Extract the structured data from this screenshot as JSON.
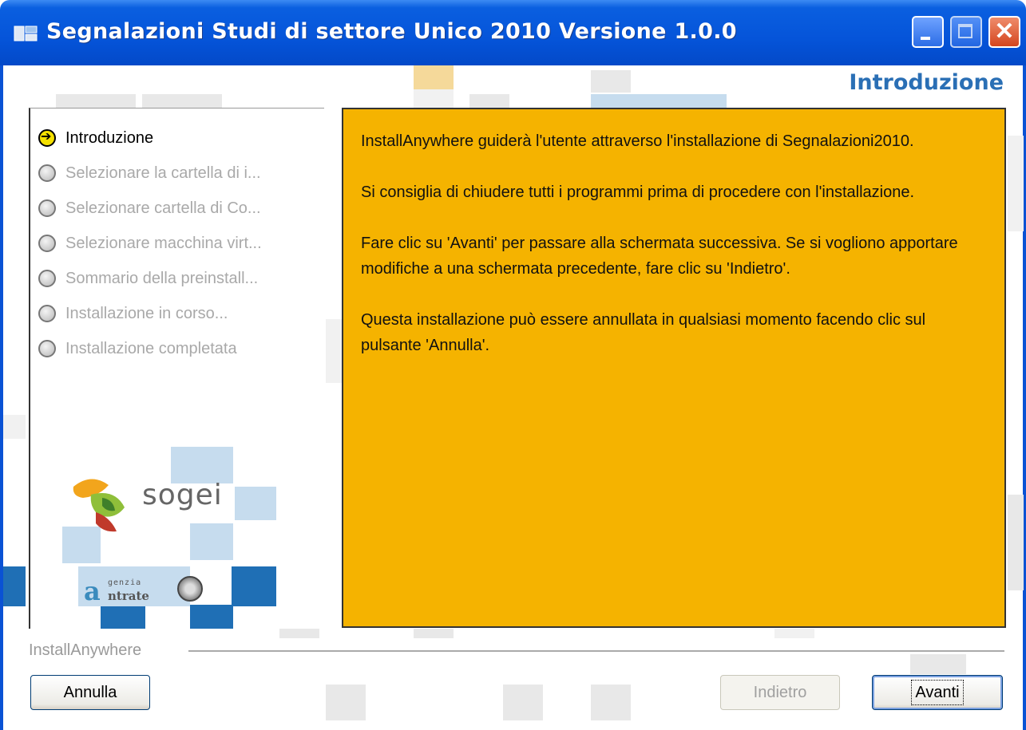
{
  "window": {
    "title": "Segnalazioni Studi di settore Unico 2010 Versione 1.0.0",
    "close_glyph": "✕"
  },
  "page_heading": "Introduzione",
  "steps": [
    {
      "label": "Introduzione",
      "state": "current"
    },
    {
      "label": "Selezionare la cartella di i...",
      "state": "pending"
    },
    {
      "label": "Selezionare cartella di Co...",
      "state": "pending"
    },
    {
      "label": "Selezionare macchina virt...",
      "state": "pending"
    },
    {
      "label": "Sommario della preinstall...",
      "state": "pending"
    },
    {
      "label": "Installazione in corso...",
      "state": "pending"
    },
    {
      "label": "Installazione completata",
      "state": "pending"
    }
  ],
  "logos": {
    "sogei": "sogei",
    "entrate_small": "genzia",
    "entrate_main": "ntrate",
    "entrate_mark": "a"
  },
  "content": {
    "paragraphs": [
      "InstallAnywhere guiderà l'utente attraverso l'installazione di Segnalazioni2010.",
      "Si consiglia di chiudere tutti i programmi prima di procedere con l'installazione.",
      "Fare clic su 'Avanti' per passare alla schermata successiva. Se si vogliono apportare modifiche a una schermata precedente, fare clic su 'Indietro'.",
      "Questa installazione può essere annullata in qualsiasi momento facendo clic sul pulsante 'Annulla'."
    ]
  },
  "footer": {
    "brand": "InstallAnywhere",
    "cancel_label": "Annulla",
    "back_label": "Indietro",
    "next_label": "Avanti"
  },
  "colors": {
    "content_background": "#f5b300",
    "title_bar": "#0554d9",
    "heading": "#2a6fb5"
  }
}
